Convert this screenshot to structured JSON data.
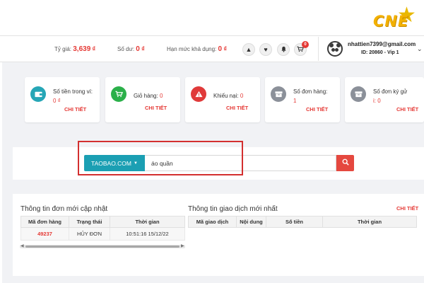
{
  "brand": {
    "logo_text": "CNE",
    "accent": "#e53935",
    "teal": "#1b9fb3"
  },
  "header": {
    "rate_label": "Tỷ giá:",
    "rate_value": "3,639",
    "balance_label": "Số dư:",
    "balance_value": "0",
    "limit_label": "Hạn mức khả dụng:",
    "limit_value": "0",
    "currency_symbol": "₫",
    "cart_count": "0",
    "user_email": "nhattien7399@gmail.com",
    "user_id": "ID: 20860 - Vip 1",
    "icons": [
      "warning-icon",
      "heart-icon",
      "bell-icon",
      "cart-icon"
    ]
  },
  "cards": [
    {
      "label": "Số tiền trong ví:",
      "value": "0 ₫",
      "link": "CHI TIẾT",
      "icon": "wallet-icon",
      "color": "#26a6b6"
    },
    {
      "label": "Giỏ hàng:",
      "value": "0",
      "link": "CHI TIẾT",
      "icon": "cart-icon",
      "color": "#2bb04a"
    },
    {
      "label": "Khiếu nại:",
      "value": "0",
      "link": "CHI TIẾT",
      "icon": "warning-icon",
      "color": "#e03a3a"
    },
    {
      "label": "Số đơn hàng:",
      "value": "1",
      "link": "CHI TIẾT",
      "icon": "box-icon",
      "color": "#8b9099"
    },
    {
      "label": "Số đơn ký gử",
      "value": "i: 0",
      "link": "CHI TIẾT",
      "icon": "box-icon",
      "color": "#8b9099"
    }
  ],
  "search": {
    "site_label": "TAOBAO.COM",
    "query": "áo quần"
  },
  "orders": {
    "title": "Thông tin đơn mới cập nhật",
    "columns": [
      "Mã đơn hàng",
      "Trạng thái",
      "Thời gian"
    ],
    "rows": [
      {
        "code": "49237",
        "status": "HỦY ĐƠN",
        "time": "10:51:16 15/12/22"
      }
    ]
  },
  "transactions": {
    "title": "Thông tin giao dịch mới nhất",
    "detail_link": "CHI TIẾT",
    "columns": [
      "Mã giao dịch",
      "Nội dung",
      "Số tiền",
      "Thời gian"
    ]
  }
}
